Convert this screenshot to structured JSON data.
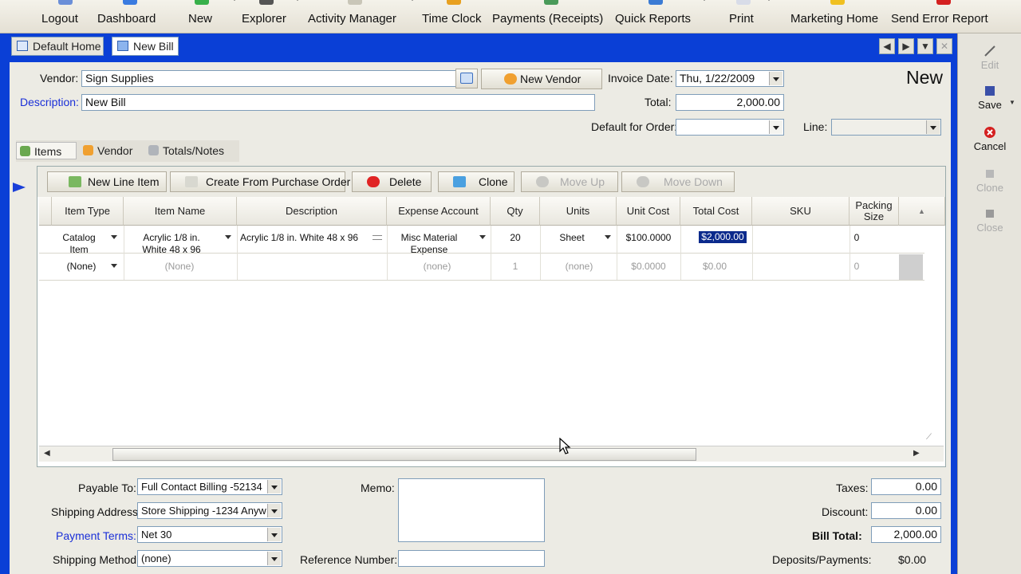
{
  "toolbar": {
    "items": [
      "Logout",
      "Dashboard",
      "New",
      "Explorer",
      "Activity Manager",
      "Time Clock",
      "Payments (Receipts)",
      "Quick Reports",
      "Print",
      "Marketing Home",
      "Send Error Report"
    ]
  },
  "tabs": {
    "home": "Default Home",
    "current": "New Bill"
  },
  "form": {
    "vendor_label": "Vendor:",
    "vendor_value": "Sign Supplies",
    "new_vendor_label": "New Vendor",
    "description_label": "Description:",
    "description_value": "New Bill",
    "invoice_date_label": "Invoice Date:",
    "invoice_date_value": "Thu, 1/22/2009",
    "total_label": "Total:",
    "total_value": "2,000.00",
    "default_order_label": "Default for Order:",
    "line_label": "Line:",
    "status": "New"
  },
  "section_tabs": [
    "Items",
    "Vendor",
    "Totals/Notes"
  ],
  "grid_toolbar": {
    "new_line": "New Line Item",
    "create_po": "Create From Purchase Order",
    "delete": "Delete",
    "clone": "Clone",
    "move_up": "Move Up",
    "move_down": "Move Down"
  },
  "grid": {
    "columns": [
      "Item Type",
      "Item Name",
      "Description",
      "Expense Account",
      "Qty",
      "Units",
      "Unit Cost",
      "Total Cost",
      "SKU",
      "Packing Size"
    ],
    "rows": [
      {
        "item_type": "Catalog Item",
        "item_name": "Acrylic 1/8 in. White 48 x 96",
        "description": "Acrylic 1/8 in. White 48 x 96",
        "expense_account": "Misc Material Expense",
        "qty": "20",
        "units": "Sheet",
        "unit_cost": "$100.0000",
        "total_cost": "$2,000.00",
        "sku": "",
        "packing_size": "0"
      },
      {
        "item_type": "(None)",
        "item_name": "(None)",
        "description": "",
        "expense_account": "(none)",
        "qty": "1",
        "units": "(none)",
        "unit_cost": "$0.0000",
        "total_cost": "$0.00",
        "sku": "",
        "packing_size": "0"
      }
    ]
  },
  "footer": {
    "payable_to_label": "Payable To:",
    "payable_to_value": "Full Contact Billing -52134",
    "shipping_address_label": "Shipping Address:",
    "shipping_address_value": "Store Shipping -1234 Anyw",
    "payment_terms_label": "Payment Terms:",
    "payment_terms_value": "Net 30",
    "shipping_method_label": "Shipping Method:",
    "shipping_method_value": "(none)",
    "memo_label": "Memo:",
    "reference_label": "Reference Number:",
    "taxes_label": "Taxes:",
    "taxes_value": "0.00",
    "discount_label": "Discount:",
    "discount_value": "0.00",
    "bill_total_label": "Bill Total:",
    "bill_total_value": "2,000.00",
    "deposits_label": "Deposits/Payments:",
    "deposits_value": "$0.00"
  },
  "side_panel": [
    "Edit",
    "Save",
    "Cancel",
    "Clone",
    "Close"
  ],
  "colors": {
    "window_blue": "#0a3fd6",
    "selection": "#0b2a8c",
    "form_bg": "#ecebe4"
  }
}
